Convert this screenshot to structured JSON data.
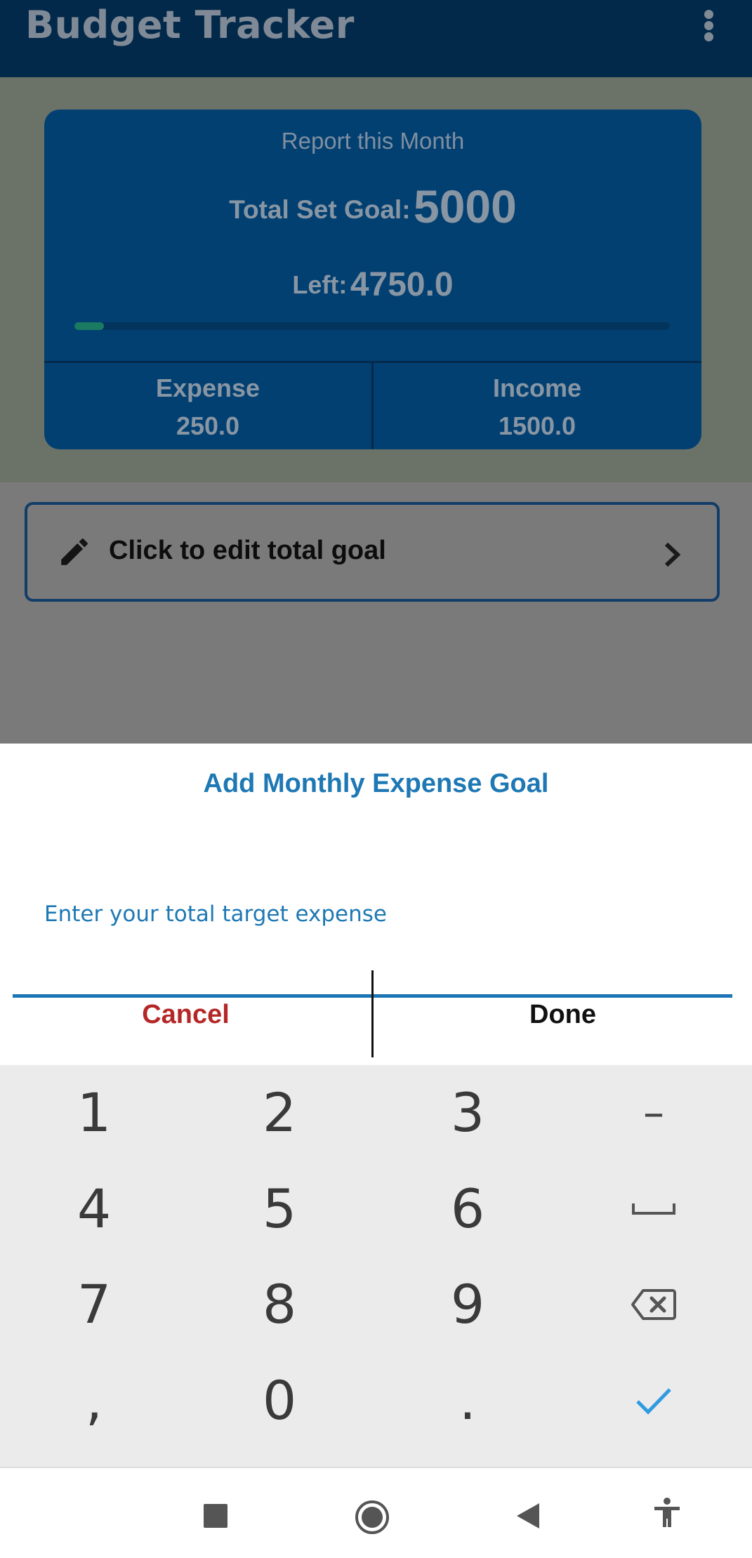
{
  "app": {
    "title": "Budget Tracker",
    "menu_icon": "more-vert-icon"
  },
  "report": {
    "title": "Report this Month",
    "goal_label": "Total Set Goal:",
    "goal_value": "5000",
    "left_label": "Left:",
    "left_value": "4750.0",
    "progress_fraction": 0.05,
    "expense_label": "Expense",
    "expense_value": "250.0",
    "income_label": "Income",
    "income_value": "1500.0"
  },
  "edit_goal": {
    "icon": "pencil-icon",
    "label": "Click to edit total goal",
    "chevron": "chevron-right-icon"
  },
  "dialog": {
    "title": "Add Monthly Expense Goal",
    "input_placeholder": "Enter your total target expense",
    "input_value": "",
    "cancel_label": "Cancel",
    "done_label": "Done"
  },
  "keyboard": {
    "keys": {
      "k1": "1",
      "k2": "2",
      "k3": "3",
      "minus": "–",
      "k4": "4",
      "k5": "5",
      "k6": "6",
      "k7": "7",
      "k8": "8",
      "k9": "9",
      "comma": ",",
      "k0": "0",
      "period": "."
    },
    "icons": [
      "space-icon",
      "backspace-icon",
      "check-icon"
    ]
  },
  "navigation": {
    "icons": [
      "recent-apps-icon",
      "home-icon",
      "back-icon",
      "accessibility-icon"
    ]
  },
  "colors": {
    "app_bar": "#03294a",
    "card": "#034072",
    "accent_blue": "#1e78b4",
    "cancel_red": "#b52727",
    "progress": "#1a7a62"
  }
}
